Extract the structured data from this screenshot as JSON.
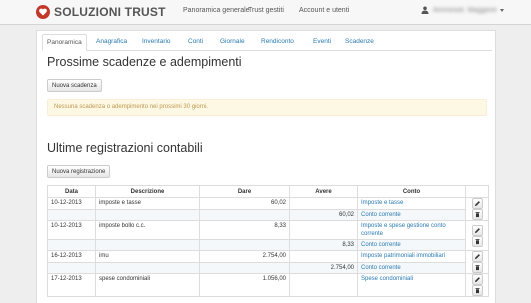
{
  "brand": {
    "name": "SOLUZIONI TRUST"
  },
  "navbar": {
    "links": [
      "Panoramica generale",
      "Trust gestiti",
      "Account e utenti"
    ],
    "user_name": "Amministr. Maggiore"
  },
  "tabs": [
    "Panoramica",
    "Anagrafica",
    "Inventario",
    "Conti",
    "Giornale",
    "Rendiconto",
    "Eventi",
    "Scadenze"
  ],
  "section1": {
    "title": "Prossime scadenze e adempimenti",
    "button": "Nuova scadenza",
    "alert": "Nessuna scadenza o adempimento nei prossimi 30 giorni."
  },
  "section2": {
    "title": "Ultime registrazioni contabili",
    "button": "Nuova registrazione",
    "columns": [
      "Data",
      "Descrizione",
      "Dare",
      "Avere",
      "Conto"
    ],
    "entries": [
      {
        "date": "10-12-2013",
        "description": "imposte e tasse",
        "dare": "60,02",
        "dare_account": "Imposte e tasse",
        "avere": "60,02",
        "avere_account": "Conto corrente"
      },
      {
        "date": "10-12-2013",
        "description": "imposte bollo c.c.",
        "dare": "8,33",
        "dare_account": "Imposte e spese gestione conto corrente",
        "avere": "8,33",
        "avere_account": "Conto corrente"
      },
      {
        "date": "16-12-2013",
        "description": "imu",
        "dare": "2.754,00",
        "dare_account": "Imposte patrimoniali immobiliari",
        "avere": "2.754,00",
        "avere_account": "Conto corrente"
      },
      {
        "date": "17-12-2013",
        "description": "spese condominiali",
        "dare": "1.056,00",
        "dare_account": "Spese condominiali",
        "avere": "",
        "avere_account": ""
      }
    ]
  },
  "icons": {
    "edit": "pencil-icon",
    "delete": "trash-icon",
    "user": "user-icon"
  },
  "colors": {
    "link": "#2a7ab0",
    "alert_bg": "#fcf8e3",
    "alert_text": "#c09853",
    "brand_red": "#c0392b"
  }
}
